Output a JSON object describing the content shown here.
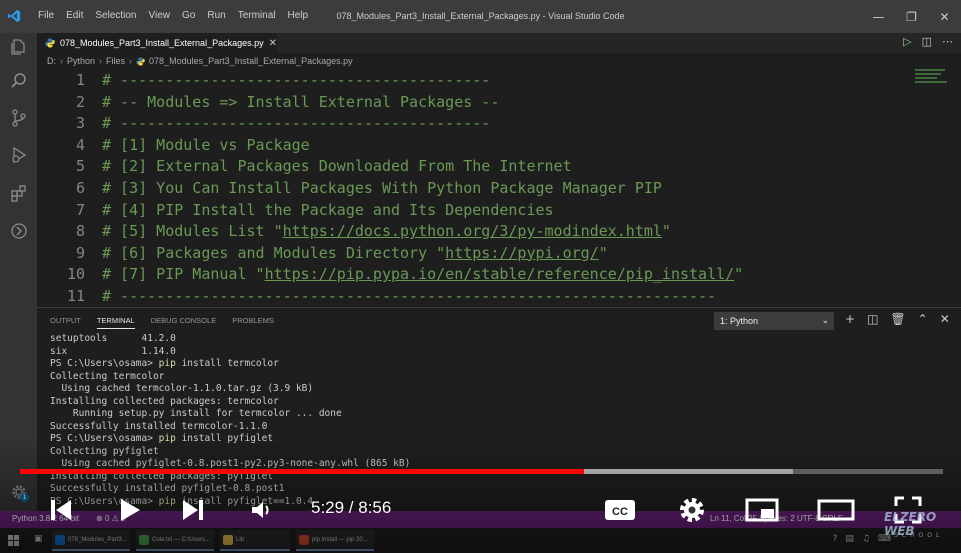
{
  "window": {
    "title": "078_Modules_Part3_Install_External_Packages.py - Visual Studio Code",
    "menu": [
      "File",
      "Edit",
      "Selection",
      "View",
      "Go",
      "Run",
      "Terminal",
      "Help"
    ]
  },
  "tab": {
    "filename": "078_Modules_Part3_Install_External_Packages.py"
  },
  "breadcrumb": [
    "D:",
    "Python",
    "Files",
    "078_Modules_Part3_Install_External_Packages.py"
  ],
  "editor": {
    "lines": [
      {
        "n": "1",
        "text": "# -----------------------------------------",
        "url": "",
        "tail": ""
      },
      {
        "n": "2",
        "text": "# -- Modules => Install External Packages --",
        "url": "",
        "tail": ""
      },
      {
        "n": "3",
        "text": "# -----------------------------------------",
        "url": "",
        "tail": ""
      },
      {
        "n": "4",
        "text": "# [1] Module vs Package",
        "url": "",
        "tail": ""
      },
      {
        "n": "5",
        "text": "# [2] External Packages Downloaded From The Internet",
        "url": "",
        "tail": ""
      },
      {
        "n": "6",
        "text": "# [3] You Can Install Packages With Python Package Manager PIP",
        "url": "",
        "tail": ""
      },
      {
        "n": "7",
        "text": "# [4] PIP Install the Package and Its Dependencies",
        "url": "",
        "tail": ""
      },
      {
        "n": "8",
        "text": "# [5] Modules List \"",
        "url": "https://docs.python.org/3/py-modindex.html",
        "tail": "\""
      },
      {
        "n": "9",
        "text": "# [6] Packages and Modules Directory \"",
        "url": "https://pypi.org/",
        "tail": "\""
      },
      {
        "n": "10",
        "text": "# [7] PIP Manual \"",
        "url": "https://pip.pypa.io/en/stable/reference/pip_install/",
        "tail": "\""
      },
      {
        "n": "11",
        "text": "# ------------------------------------------------------------------",
        "url": "",
        "tail": ""
      }
    ]
  },
  "panel": {
    "tabs": [
      "OUTPUT",
      "TERMINAL",
      "DEBUG CONSOLE",
      "PROBLEMS"
    ],
    "active_tab": "TERMINAL",
    "terminal_select": "1: Python",
    "terminal_lines": [
      {
        "pre": "setuptools      41.2.0",
        "cmd": "",
        "post": ""
      },
      {
        "pre": "six             1.14.0",
        "cmd": "",
        "post": ""
      },
      {
        "pre": "PS C:\\Users\\osama> ",
        "cmd": "pip",
        "post": " install termcolor"
      },
      {
        "pre": "Collecting termcolor",
        "cmd": "",
        "post": ""
      },
      {
        "pre": "  Using cached termcolor-1.1.0.tar.gz (3.9 kB)",
        "cmd": "",
        "post": ""
      },
      {
        "pre": "Installing collected packages: termcolor",
        "cmd": "",
        "post": ""
      },
      {
        "pre": "    Running setup.py install for termcolor ... done",
        "cmd": "",
        "post": ""
      },
      {
        "pre": "Successfully installed termcolor-1.1.0",
        "cmd": "",
        "post": ""
      },
      {
        "pre": "PS C:\\Users\\osama> ",
        "cmd": "pip",
        "post": " install pyfiglet"
      },
      {
        "pre": "Collecting pyfiglet",
        "cmd": "",
        "post": ""
      },
      {
        "pre": "  Using cached pyfiglet-0.8.post1-py2.py3-none-any.whl (865 kB)",
        "cmd": "",
        "post": ""
      },
      {
        "pre": "Installing collected packages: pyfiglet",
        "cmd": "",
        "post": ""
      },
      {
        "pre": "Successfully installed pyfiglet-0.8.post1",
        "cmd": "",
        "post": ""
      },
      {
        "pre": "PS C:\\Users\\osama> ",
        "cmd": "pip",
        "post": " install pyfiglet==1.0.4"
      }
    ]
  },
  "statusbar": {
    "interpreter": "Python 3.8.2 64-bit",
    "problems": "⊗ 0 ⚠ 0",
    "position": "Ln 11, Col 25   Spaces: 2   UTF-8   CRLF"
  },
  "taskbar": {
    "apps": [
      {
        "label": "078_Modules_Part3...",
        "color": "#0e7ad1"
      },
      {
        "label": "Cola.txt — C:\\Users...",
        "color": "#4caf50"
      },
      {
        "label": "Lib",
        "color": "#f2c94c"
      },
      {
        "label": "pip install — pip 20...",
        "color": "#e34f26"
      }
    ]
  },
  "video": {
    "timecode": "5:29 / 8:56",
    "played_fraction": 0.6115,
    "loaded_fraction": 0.838
  },
  "watermark": {
    "line1": "ELZERO WEB",
    "line2": "SCHOOL"
  },
  "icons": {
    "manage": "gear-icon",
    "manage_badge": "1"
  }
}
